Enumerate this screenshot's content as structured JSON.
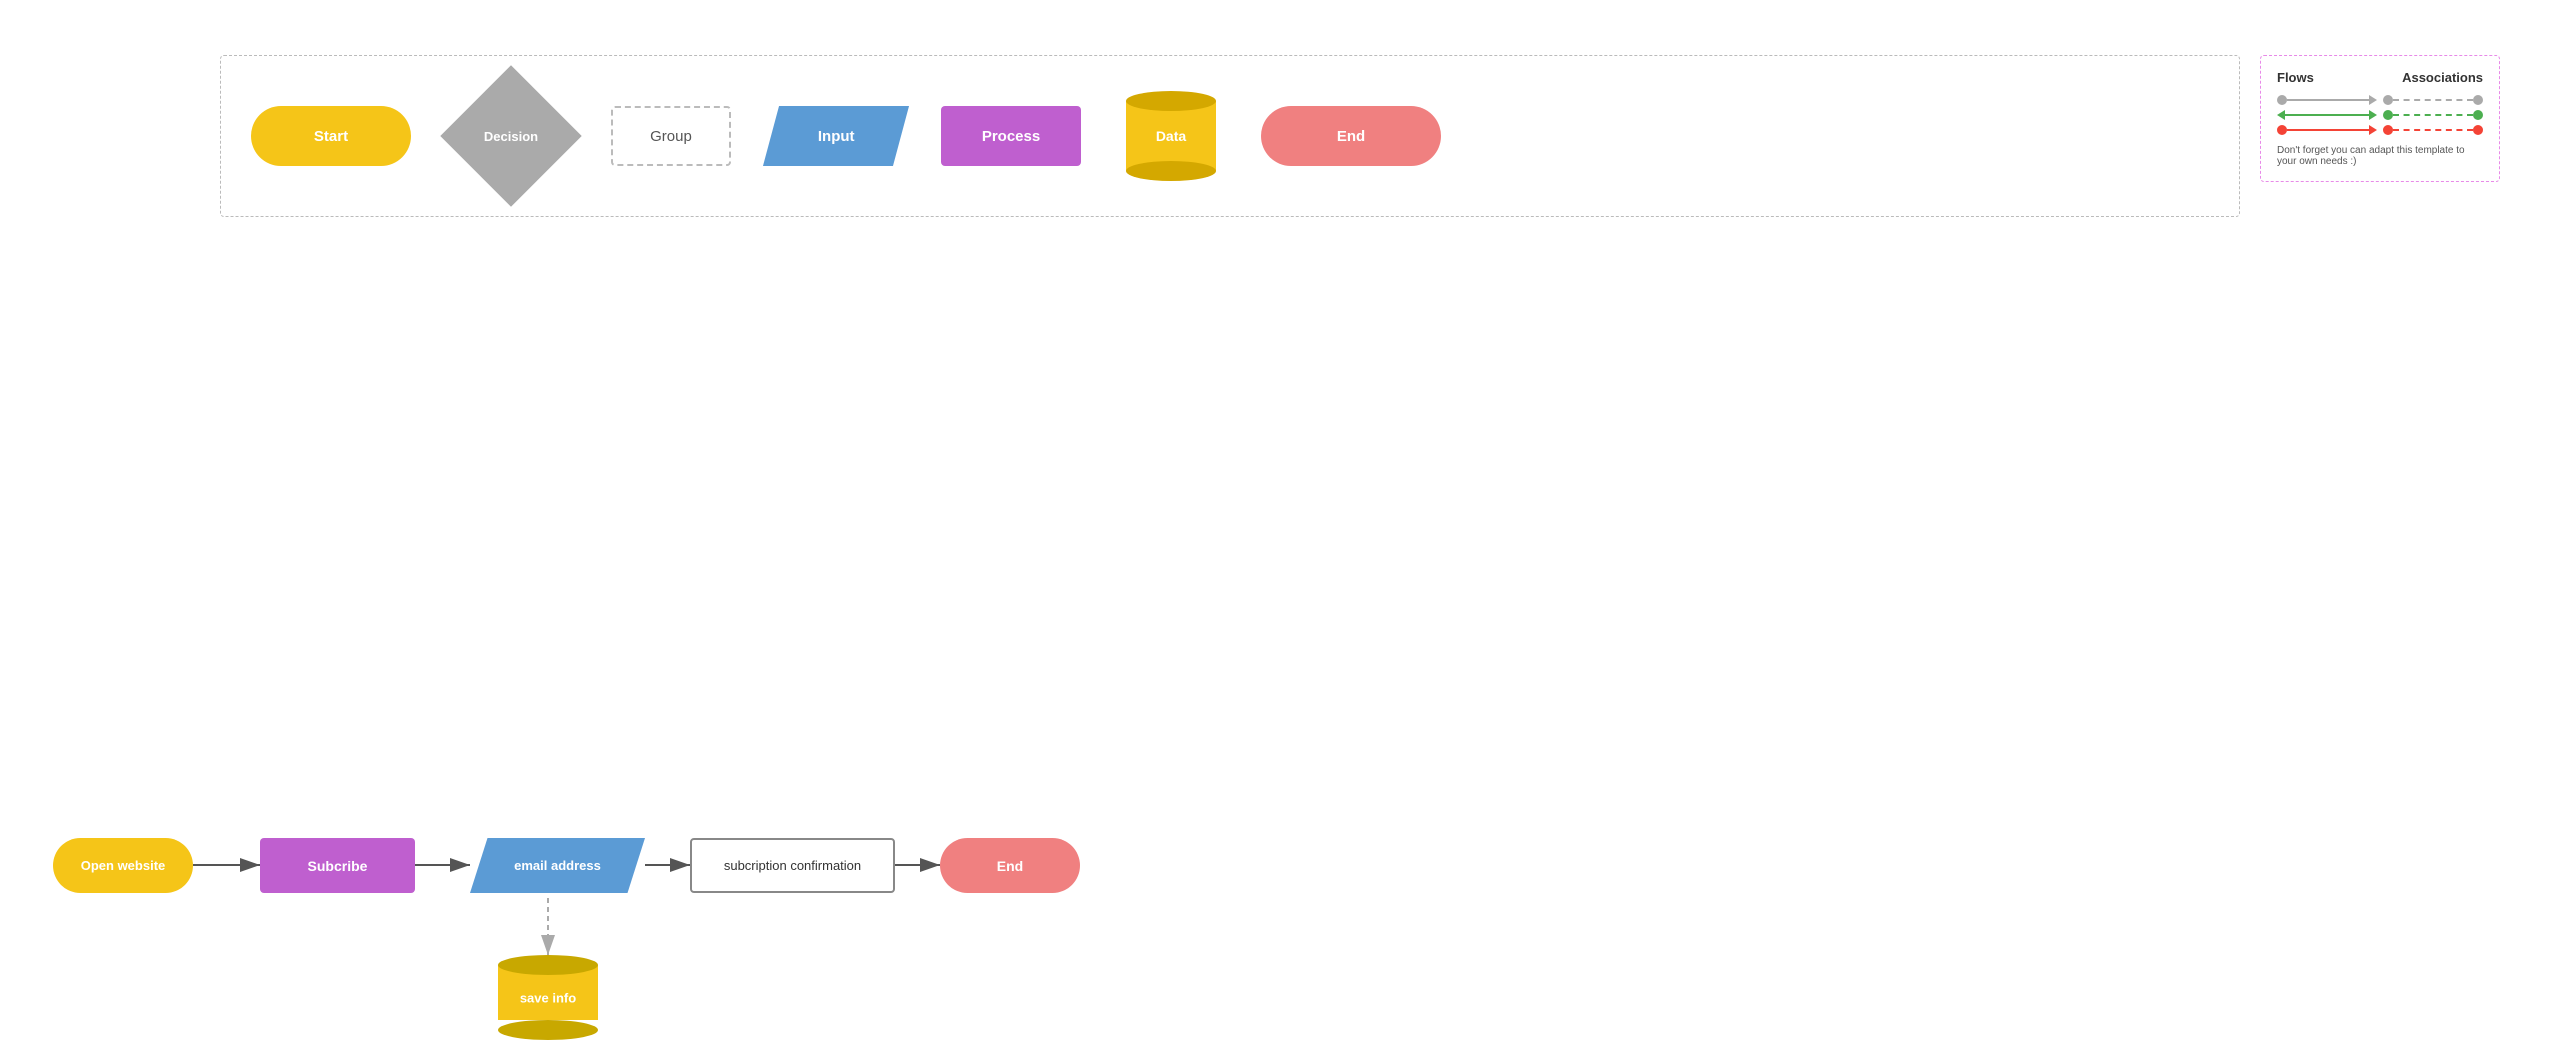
{
  "legend": {
    "title": "Flows",
    "assoc_title": "Associations",
    "note": "Don't forget you can adapt this template to your own needs :)"
  },
  "shapes": [
    {
      "id": "start",
      "label": "Start",
      "type": "start"
    },
    {
      "id": "decision",
      "label": "Decision",
      "type": "decision"
    },
    {
      "id": "group",
      "label": "Group",
      "type": "group"
    },
    {
      "id": "input",
      "label": "Input",
      "type": "input"
    },
    {
      "id": "process",
      "label": "Process",
      "type": "process"
    },
    {
      "id": "data",
      "label": "Data",
      "type": "data"
    },
    {
      "id": "end",
      "label": "End",
      "type": "end"
    }
  ],
  "flowchart": {
    "nodes": [
      {
        "id": "open-website",
        "label": "Open website",
        "type": "start"
      },
      {
        "id": "subscribe",
        "label": "Subcribe",
        "type": "process"
      },
      {
        "id": "email-address",
        "label": "email address",
        "type": "input"
      },
      {
        "id": "subscription-confirmation",
        "label": "subcription confirmation",
        "type": "confirm"
      },
      {
        "id": "end",
        "label": "End",
        "type": "end"
      },
      {
        "id": "save-info",
        "label": "save info",
        "type": "data"
      }
    ]
  }
}
